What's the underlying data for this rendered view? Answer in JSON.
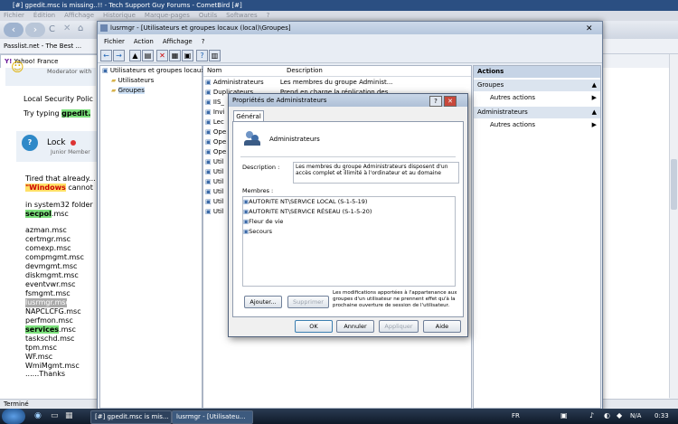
{
  "browser": {
    "title": "[#] gpedit.msc is missing..!! - Tech Support Guy Forums - CometBird [#]",
    "menu": [
      "Fichier",
      "Édition",
      "Affichage",
      "Historique",
      "Marque-pages",
      "Outils",
      "Softwares",
      "?"
    ],
    "bookmarks": [
      "Passlist.net - The Best ..."
    ],
    "tab": "Yahoo! France",
    "status": "Terminé"
  },
  "forum": {
    "moderator": "Moderator with",
    "local_policy": "Local Security Polic",
    "try_prefix": "Try typing ",
    "try_cmd": "gpedit.",
    "user": "Lock",
    "rank": "Junior Member",
    "tired": "Tired that already...",
    "windows_word": "\"Windows",
    "cannot": "cannot",
    "sys32": "in system32 folder ..",
    "secpol": "secpol",
    "msc": ".msc",
    "files": [
      "azman.msc",
      "certmgr.msc",
      "comexp.msc",
      "compmgmt.msc",
      "devmgmt.msc",
      "diskmgmt.msc",
      "eventvwr.msc",
      "fsmgmt.msc",
      "lusrmgr.msc",
      "NAPCLCFG.msc",
      "perfmon.msc"
    ],
    "services": "services",
    "files2": [
      "taskschd.msc",
      "tpm.msc",
      "WF.msc",
      "WmiMgmt.msc"
    ],
    "thanks": "......Thanks"
  },
  "mmc": {
    "title": "lusrmgr - [Utilisateurs et groupes locaux (local)\\Groupes]",
    "menu": [
      "Fichier",
      "Action",
      "Affichage",
      "?"
    ],
    "tree": [
      "Utilisateurs et groupes locaux (lo",
      "Utilisateurs",
      "Groupes"
    ],
    "col_name": "Nom",
    "col_desc": "Description",
    "rows": [
      {
        "name": "Administrateurs",
        "desc": "Les membres du groupe Administ..."
      },
      {
        "name": "Duplicateurs",
        "desc": "Prend en charge la réplication des..."
      },
      {
        "name": "IIS_",
        "desc": ""
      },
      {
        "name": "Invi",
        "desc": ""
      },
      {
        "name": "Lec",
        "desc": ""
      },
      {
        "name": "Ope",
        "desc": ""
      },
      {
        "name": "Ope",
        "desc": ""
      },
      {
        "name": "Ope",
        "desc": ""
      },
      {
        "name": "Util",
        "desc": ""
      },
      {
        "name": "Util",
        "desc": ""
      },
      {
        "name": "Util",
        "desc": ""
      },
      {
        "name": "Util",
        "desc": ""
      },
      {
        "name": "Util",
        "desc": ""
      },
      {
        "name": "Util",
        "desc": ""
      }
    ],
    "actions": {
      "header": "Actions",
      "groups": "Groupes",
      "more1": "Autres actions",
      "admins": "Administrateurs",
      "more2": "Autres actions"
    }
  },
  "dialog": {
    "title": "Propriétés de Administrateurs",
    "tab": "Général",
    "group_name": "Administrateurs",
    "desc_label": "Description :",
    "desc_value": "Les membres du groupe Administrateurs disposent d'un accès complet et illimité à l'ordinateur et au domaine",
    "members_label": "Membres :",
    "members": [
      "AUTORITE NT\\SERVICE LOCAL (S-1-5-19)",
      "AUTORITE NT\\SERVICE RÉSEAU (S-1-5-20)",
      "Fleur de vie",
      "Secours"
    ],
    "add": "Ajouter...",
    "remove": "Supprimer",
    "note": "Les modifications apportées à l'appartenance aux groupes d'un utilisateur ne prennent effet qu'à la prochaine ouverture de session de l'utilisateur.",
    "ok": "OK",
    "cancel": "Annuler",
    "apply": "Appliquer",
    "help": "Aide"
  },
  "taskbar": {
    "task1": "[#] gpedit.msc is mis...",
    "task2": "lusrmgr - [Utilisateu...",
    "lang": "FR",
    "na": "N/A",
    "clock": "0:33"
  }
}
